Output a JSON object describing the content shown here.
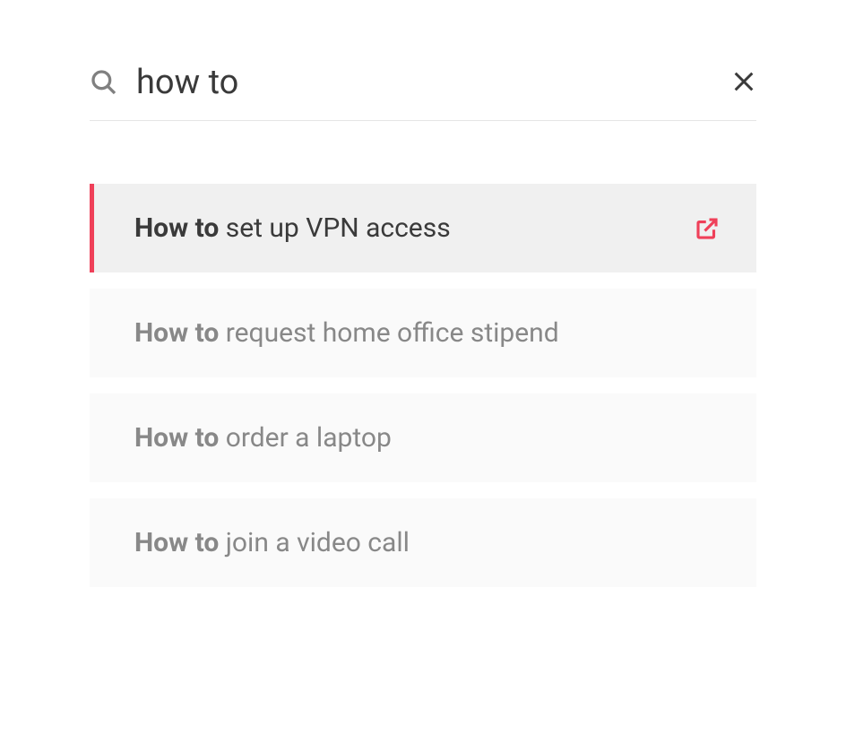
{
  "search": {
    "query": "how to"
  },
  "results": [
    {
      "match": "How to",
      "rest": " set up VPN access",
      "selected": true
    },
    {
      "match": "How to",
      "rest": " request home office stipend",
      "selected": false
    },
    {
      "match": "How to",
      "rest": " order a laptop",
      "selected": false
    },
    {
      "match": "How to",
      "rest": " join a video call",
      "selected": false
    }
  ]
}
